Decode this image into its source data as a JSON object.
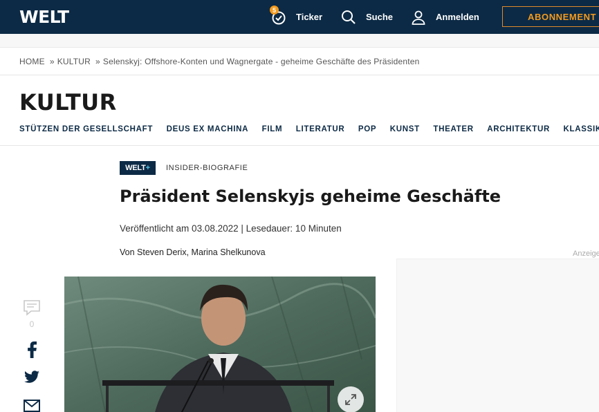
{
  "header": {
    "logo": "WELT",
    "ticker_badge": "5",
    "ticker_label": "Ticker",
    "search_label": "Suche",
    "login_label": "Anmelden",
    "subscribe_label": "ABONNEMENT"
  },
  "breadcrumb": {
    "items": [
      "HOME",
      "KULTUR",
      "Selenskyj: Offshore-Konten und Wagnergate - geheime Geschäfte des Präsidenten"
    ],
    "separator": "»"
  },
  "section": {
    "title": "KULTUR",
    "subnav": [
      "STÜTZEN DER GESELLSCHAFT",
      "DEUS EX MACHINA",
      "FILM",
      "LITERATUR",
      "POP",
      "KUNST",
      "THEATER",
      "ARCHITEKTUR",
      "KLASSIK"
    ]
  },
  "article": {
    "brand_badge": "WELT",
    "brand_badge_plus": "+",
    "kicker": "INSIDER-BIOGRAFIE",
    "headline": "Präsident Selenskyjs geheime Geschäfte",
    "meta": "Veröffentlicht am 03.08.2022 | Lesedauer: 10 Minuten",
    "author": "Von Steven Derix, Marina Shelkunova"
  },
  "share": {
    "comment_count": "0",
    "icons": [
      "comment-icon",
      "facebook-icon",
      "twitter-icon",
      "mail-icon"
    ]
  },
  "ad": {
    "label": "Anzeige"
  },
  "colors": {
    "navy": "#0c2a45",
    "accent_orange": "#f49b1e",
    "plus_cyan": "#56c7e8"
  }
}
